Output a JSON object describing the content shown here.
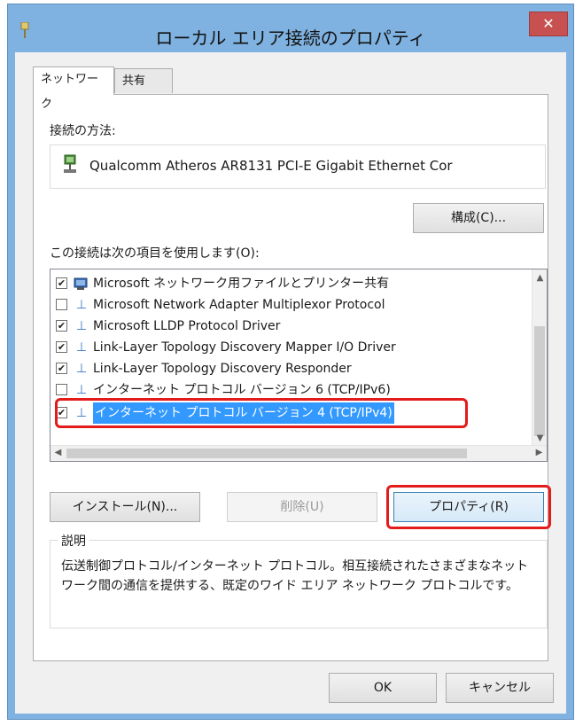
{
  "window": {
    "title": "ローカル エリア接続のプロパティ",
    "close_label": "✕"
  },
  "tabs": [
    {
      "label": "ネットワーク",
      "active": true
    },
    {
      "label": "共有",
      "active": false
    }
  ],
  "connect_using_label": "接続の方法:",
  "adapter_name": "Qualcomm Atheros AR8131 PCI-E Gigabit Ethernet Cor",
  "configure_button": "構成(C)...",
  "items_label": "この接続は次の項目を使用します(O):",
  "items": [
    {
      "label": "Microsoft ネットワーク用ファイルとプリンター共有",
      "checked": true,
      "icon": "network-share-icon"
    },
    {
      "label": "Microsoft Network Adapter Multiplexor Protocol",
      "checked": false,
      "icon": "protocol-icon"
    },
    {
      "label": "Microsoft LLDP Protocol Driver",
      "checked": true,
      "icon": "protocol-icon"
    },
    {
      "label": "Link-Layer Topology Discovery Mapper I/O Driver",
      "checked": true,
      "icon": "protocol-icon"
    },
    {
      "label": "Link-Layer Topology Discovery Responder",
      "checked": true,
      "icon": "protocol-icon"
    },
    {
      "label": "インターネット プロトコル バージョン 6 (TCP/IPv6)",
      "checked": false,
      "icon": "protocol-icon"
    },
    {
      "label": "インターネット プロトコル バージョン 4 (TCP/IPv4)",
      "checked": true,
      "icon": "protocol-icon",
      "selected": true
    }
  ],
  "buttons": {
    "install": "インストール(N)...",
    "uninstall": "削除(U)",
    "properties": "プロパティ(R)",
    "ok": "OK",
    "cancel": "キャンセル"
  },
  "description": {
    "legend": "説明",
    "text": "伝送制御プロトコル/インターネット プロトコル。相互接続されたさまざまなネットワーク間の通信を提供する、既定のワイド エリア ネットワーク プロトコルです。"
  },
  "colors": {
    "title_bar": "#7fb2e0",
    "close_button": "#c75050",
    "selection": "#3399ff",
    "highlight_annotation": "#e41b1b"
  }
}
